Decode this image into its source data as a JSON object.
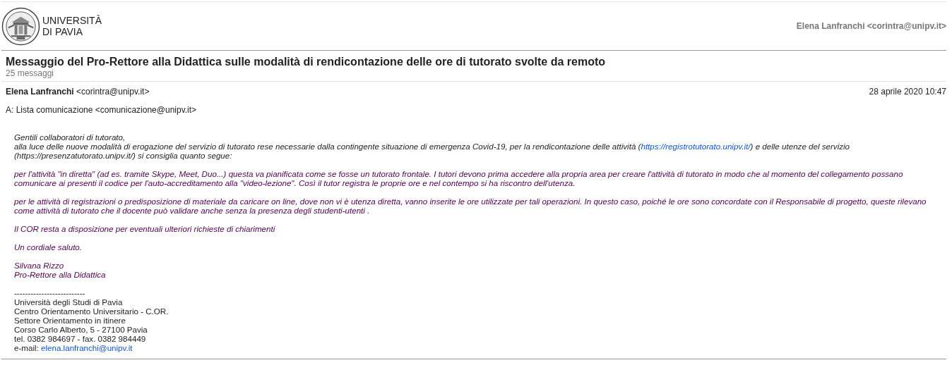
{
  "header": {
    "logo_lines": [
      "UNIVERSITÀ",
      "DI PAVIA"
    ],
    "account": "Elena Lanfranchi <corintra@unipv.it>"
  },
  "thread": {
    "subject": "Messaggio del Pro-Rettore alla Didattica sulle modalità di rendicontazione delle ore di tutorato svolte da remoto",
    "count": "25 messaggi"
  },
  "message": {
    "sender_name": "Elena Lanfranchi",
    "sender_email": "<corintra@unipv.it>",
    "date": "28 aprile 2020 10:47",
    "to": "A: Lista comunicazione <comunicazione@unipv.it>",
    "paragraphs": [
      [
        [
          {
            "text": "Gentili collaboratori di tutorato,"
          }
        ],
        [
          {
            "text": "alla luce delle nuove modalità di erogazione del servizio di tutorato rese necessarie dalla contingente situazione di emergenza Covid-19, per la rendicontazione delle attività ("
          },
          {
            "link": "https://registrotutorato.unipv.it/"
          },
          {
            "text": ") e delle utenze del servizio"
          }
        ],
        [
          {
            "text": "(https://presenzatutorato.unipv.it/) si consiglia quanto segue:"
          }
        ]
      ],
      [
        [
          {
            "text": "per l'attività \"in diretta\" (ad es. tramite Skype, Meet, Duo...) questa va pianificata come se fosse un tutorato frontale. I tutori devono prima accedere alla propria area per creare l'attività di tutorato in modo che al momento del collegamento possano"
          }
        ],
        [
          {
            "text": "comunicare ai presenti il codice per l'auto-accreditamento alla \"video-lezione\".  Così il tutor registra le proprie ore e nel contempo si ha riscontro dell'utenza."
          }
        ]
      ],
      [
        [
          {
            "text": "per le attività di registrazioni o predisposizione di materiale da caricare on line, dove non vi è utenza diretta, vanno inserite le ore utilizzate per tali operazioni. In questo caso, poiché le ore sono concordate con il Responsabile di progetto, queste rilevano"
          }
        ],
        [
          {
            "text": "come attività di tutorato che il docente può validare anche senza la presenza degli studenti-utenti ."
          }
        ]
      ],
      [
        [
          {
            "text": "Il COR resta a disposizione per eventuali ulteriori richieste di chiarimenti"
          }
        ]
      ],
      [
        [
          {
            "text": "Un cordiale saluto."
          }
        ]
      ],
      [
        [
          {
            "text": "Silvana Rizzo"
          }
        ],
        [
          {
            "text": "Pro-Rettore alla Didattica"
          }
        ]
      ]
    ],
    "signature": [
      "--------------------------",
      "Università degli Studi di Pavia",
      "Centro Orientamento Universitario - C.OR.",
      "Settore Orientamento in itinere",
      "Corso Carlo Alberto, 5 - 27100 Pavia",
      "tel. 0382 984697 - fax. 0382 984449"
    ],
    "signature_email_label": "e-mail: ",
    "signature_email": "elena.lanfranchi@unipv.it"
  }
}
